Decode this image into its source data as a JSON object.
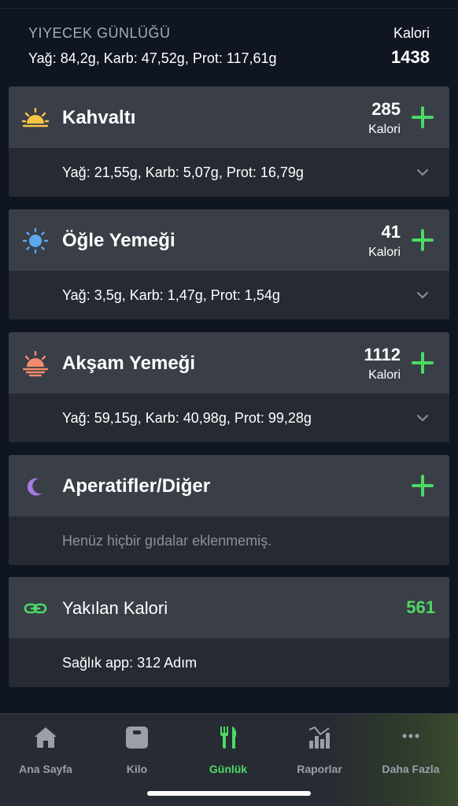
{
  "summary": {
    "title": "YIYECEK GÜNLÜĞÜ",
    "macros": "Yağ: 84,2g, Karb: 47,52g, Prot: 117,61g",
    "calorie_label": "Kalori",
    "calorie_total": "1438"
  },
  "meals": [
    {
      "name": "Kahvaltı",
      "kcal": "285",
      "kcal_label": "Kalori",
      "macros": "Yağ: 21,55g, Karb: 5,07g, Prot: 16,79g",
      "icon": "sunrise-icon"
    },
    {
      "name": "Öğle Yemeği",
      "kcal": "41",
      "kcal_label": "Kalori",
      "macros": "Yağ: 3,5g, Karb: 1,47g, Prot: 1,54g",
      "icon": "sun-icon"
    },
    {
      "name": "Akşam Yemeği",
      "kcal": "1112",
      "kcal_label": "Kalori",
      "macros": "Yağ: 59,15g, Karb: 40,98g, Prot: 99,28g",
      "icon": "sunset-icon"
    },
    {
      "name": "Aperatifler/Diğer",
      "empty_message": "Henüz hiçbir gıdalar eklenmemiş.",
      "icon": "moon-icon"
    }
  ],
  "burned": {
    "label": "Yakılan Kalori",
    "value": "561",
    "detail": "Sağlık app: 312 Adım",
    "icon": "link-icon"
  },
  "tabs": [
    {
      "label": "Ana Sayfa",
      "icon": "home-icon"
    },
    {
      "label": "Kilo",
      "icon": "scale-icon"
    },
    {
      "label": "Günlük",
      "icon": "fork-knife-icon",
      "active": true
    },
    {
      "label": "Raporlar",
      "icon": "chart-icon"
    },
    {
      "label": "Daha Fazla",
      "icon": "more-icon"
    }
  ],
  "colors": {
    "background": "#0f1521",
    "card_header": "#3a3e47",
    "card_body": "#262b33",
    "accent_green": "#4cd964",
    "muted_text": "#8b919c"
  }
}
